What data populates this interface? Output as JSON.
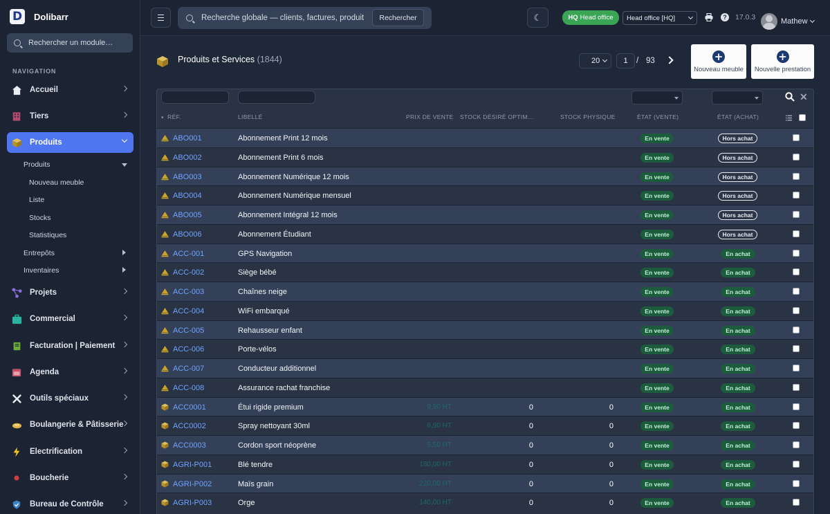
{
  "app": {
    "name": "Dolibarr",
    "version": "17.0.3"
  },
  "sidebar": {
    "search_placeholder": "Rechercher un module…",
    "heading": "NAVIGATION",
    "items": [
      {
        "label": "Accueil",
        "icon": "home-icon",
        "color": "#e8ecf3"
      },
      {
        "label": "Tiers",
        "icon": "building-icon",
        "color": "#b04a6f"
      },
      {
        "label": "Produits",
        "icon": "cube-icon",
        "color": "#c9a227",
        "active": true
      },
      {
        "label": "Projets",
        "icon": "project-icon",
        "color": "#8a6fd8"
      },
      {
        "label": "Commercial",
        "icon": "briefcase-icon",
        "color": "#2ab3a0"
      },
      {
        "label": "Facturation | Paiement",
        "icon": "invoice-icon",
        "color": "#6cab3c"
      },
      {
        "label": "Agenda",
        "icon": "calendar-icon",
        "color": "#c2506b"
      },
      {
        "label": "Outils spéciaux",
        "icon": "tools-icon",
        "color": "#e8ecf3"
      },
      {
        "label": "Boulangerie & Pâtisserie",
        "icon": "bread-icon",
        "color": "#e0b44a"
      },
      {
        "label": "Electrification",
        "icon": "bolt-icon",
        "color": "#f0c419"
      },
      {
        "label": "Boucherie",
        "icon": "meat-icon",
        "color": "#d33c3c"
      },
      {
        "label": "Bureau de Contrôle",
        "icon": "shield-icon",
        "color": "#3b82c4"
      }
    ],
    "sub": {
      "produits": "Produits",
      "nouveau": "Nouveau meuble",
      "liste": "Liste",
      "stocks": "Stocks",
      "statistiques": "Statistiques",
      "entrepots": "Entrepôts",
      "inventaires": "Inventaires"
    }
  },
  "topbar": {
    "search_placeholder": "Recherche globale — clients, factures, produits…",
    "search_button": "Rechercher",
    "hq_code": "HQ",
    "hq_label": "Head office",
    "entity": "Head office [HQ]",
    "user": "Mathew"
  },
  "page": {
    "title": "Produits et Services",
    "count": "(1844)",
    "per_page": "20",
    "current_page": "1",
    "page_sep": "/",
    "total_pages": "93",
    "new_furniture": "Nouveau meuble",
    "new_service": "Nouvelle prestation"
  },
  "table": {
    "headers": {
      "ref": "RÉF.",
      "label": "LIBELLÉ",
      "price": "PRIX DE VENTE",
      "stock_desired": "STOCK DÉSIRÉ OPTIM…",
      "stock_physical": "STOCK PHYSIQUE",
      "state_sell": "ÉTAT (VENTE)",
      "state_buy": "ÉTAT (ACHAT)"
    },
    "rows": [
      {
        "type": "service",
        "ref": "ABO001",
        "label": "Abonnement Print 12 mois",
        "price": "",
        "stock_desired": "",
        "stock_physical": "",
        "sell": "En vente",
        "buy": "Hors achat",
        "buy_on": false
      },
      {
        "type": "service",
        "ref": "ABO002",
        "label": "Abonnement Print 6 mois",
        "price": "",
        "stock_desired": "",
        "stock_physical": "",
        "sell": "En vente",
        "buy": "Hors achat",
        "buy_on": false
      },
      {
        "type": "service",
        "ref": "ABO003",
        "label": "Abonnement Numérique 12 mois",
        "price": "",
        "stock_desired": "",
        "stock_physical": "",
        "sell": "En vente",
        "buy": "Hors achat",
        "buy_on": false
      },
      {
        "type": "service",
        "ref": "ABO004",
        "label": "Abonnement Numérique mensuel",
        "price": "",
        "stock_desired": "",
        "stock_physical": "",
        "sell": "En vente",
        "buy": "Hors achat",
        "buy_on": false
      },
      {
        "type": "service",
        "ref": "ABO005",
        "label": "Abonnement Intégral 12 mois",
        "price": "",
        "stock_desired": "",
        "stock_physical": "",
        "sell": "En vente",
        "buy": "Hors achat",
        "buy_on": false
      },
      {
        "type": "service",
        "ref": "ABO006",
        "label": "Abonnement Étudiant",
        "price": "",
        "stock_desired": "",
        "stock_physical": "",
        "sell": "En vente",
        "buy": "Hors achat",
        "buy_on": false
      },
      {
        "type": "service",
        "ref": "ACC-001",
        "label": "GPS Navigation",
        "price": "",
        "stock_desired": "",
        "stock_physical": "",
        "sell": "En vente",
        "buy": "En achat",
        "buy_on": true
      },
      {
        "type": "service",
        "ref": "ACC-002",
        "label": "Siège bébé",
        "price": "",
        "stock_desired": "",
        "stock_physical": "",
        "sell": "En vente",
        "buy": "En achat",
        "buy_on": true
      },
      {
        "type": "service",
        "ref": "ACC-003",
        "label": "Chaînes neige",
        "price": "",
        "stock_desired": "",
        "stock_physical": "",
        "sell": "En vente",
        "buy": "En achat",
        "buy_on": true
      },
      {
        "type": "service",
        "ref": "ACC-004",
        "label": "WiFi embarqué",
        "price": "",
        "stock_desired": "",
        "stock_physical": "",
        "sell": "En vente",
        "buy": "En achat",
        "buy_on": true
      },
      {
        "type": "service",
        "ref": "ACC-005",
        "label": "Rehausseur enfant",
        "price": "",
        "stock_desired": "",
        "stock_physical": "",
        "sell": "En vente",
        "buy": "En achat",
        "buy_on": true
      },
      {
        "type": "service",
        "ref": "ACC-006",
        "label": "Porte-vélos",
        "price": "",
        "stock_desired": "",
        "stock_physical": "",
        "sell": "En vente",
        "buy": "En achat",
        "buy_on": true
      },
      {
        "type": "service",
        "ref": "ACC-007",
        "label": "Conducteur additionnel",
        "price": "",
        "stock_desired": "",
        "stock_physical": "",
        "sell": "En vente",
        "buy": "En achat",
        "buy_on": true
      },
      {
        "type": "service",
        "ref": "ACC-008",
        "label": "Assurance rachat franchise",
        "price": "",
        "stock_desired": "",
        "stock_physical": "",
        "sell": "En vente",
        "buy": "En achat",
        "buy_on": true
      },
      {
        "type": "product",
        "ref": "ACC0001",
        "label": "Étui rigide premium",
        "price": "9,90 HT",
        "stock_desired": "0",
        "stock_physical": "0",
        "sell": "En vente",
        "buy": "En achat",
        "buy_on": true
      },
      {
        "type": "product",
        "ref": "ACC0002",
        "label": "Spray nettoyant 30ml",
        "price": "6,90 HT",
        "stock_desired": "0",
        "stock_physical": "0",
        "sell": "En vente",
        "buy": "En achat",
        "buy_on": true
      },
      {
        "type": "product",
        "ref": "ACC0003",
        "label": "Cordon sport néoprène",
        "price": "5,50 HT",
        "stock_desired": "0",
        "stock_physical": "0",
        "sell": "En vente",
        "buy": "En achat",
        "buy_on": true
      },
      {
        "type": "product",
        "ref": "AGRI-P001",
        "label": "Blé tendre",
        "price": "180,00 HT",
        "stock_desired": "0",
        "stock_physical": "0",
        "sell": "En vente",
        "buy": "En achat",
        "buy_on": true
      },
      {
        "type": "product",
        "ref": "AGRI-P002",
        "label": "Maïs grain",
        "price": "220,00 HT",
        "stock_desired": "0",
        "stock_physical": "0",
        "sell": "En vente",
        "buy": "En achat",
        "buy_on": true
      },
      {
        "type": "product",
        "ref": "AGRI-P003",
        "label": "Orge",
        "price": "140,00 HT",
        "stock_desired": "0",
        "stock_physical": "0",
        "sell": "En vente",
        "buy": "En achat",
        "buy_on": true
      }
    ]
  }
}
